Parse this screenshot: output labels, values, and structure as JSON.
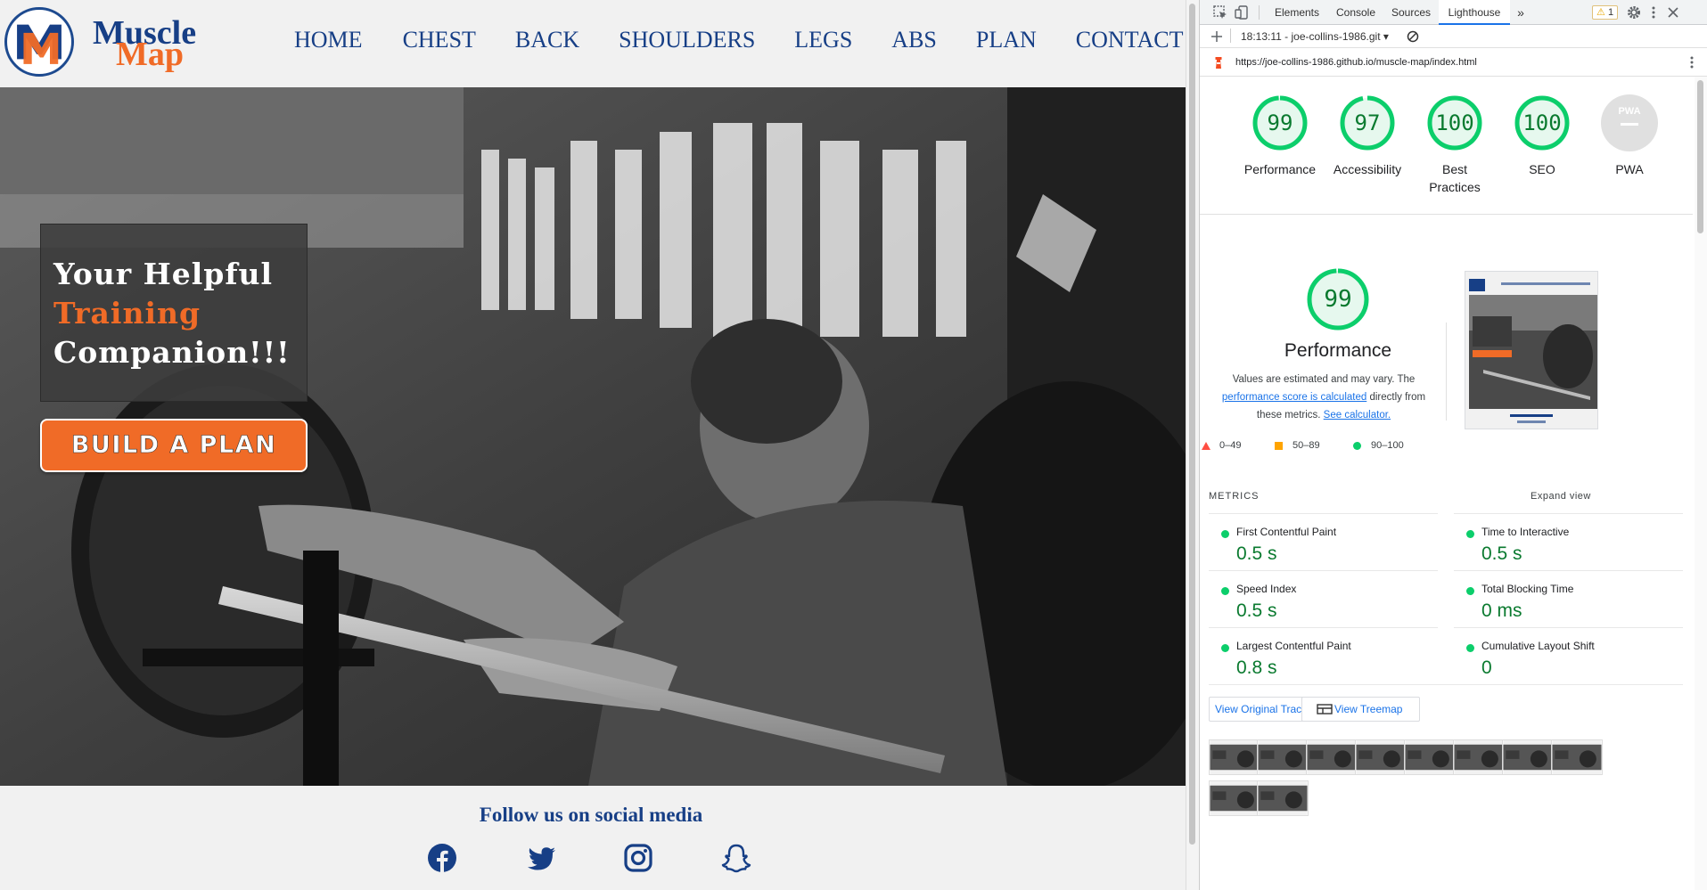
{
  "site": {
    "logo_line1": "Muscle",
    "logo_line2": "Map",
    "nav": [
      "HOME",
      "CHEST",
      "BACK",
      "SHOULDERS",
      "LEGS",
      "ABS",
      "PLAN",
      "CONTACT"
    ],
    "hero": {
      "line1": "Your Helpful",
      "line2": "Training",
      "line3": "Companion!!!",
      "cta": "BUILD A PLAN"
    },
    "social_title": "Follow us on social media",
    "social_icons": [
      "facebook-icon",
      "twitter-icon",
      "instagram-icon",
      "snapchat-icon"
    ],
    "colors": {
      "brand_blue": "#173f86",
      "brand_orange": "#f06b27"
    }
  },
  "devtools": {
    "tabs": [
      "Elements",
      "Console",
      "Sources",
      "Lighthouse"
    ],
    "active_tab": "Lighthouse",
    "more_tabs": "»",
    "warning_count": "1",
    "report_selector": "18:13:11 - joe-collins-1986.git ▾",
    "url": "https://joe-collins-1986.github.io/muscle-map/index.html",
    "scores": [
      {
        "label": "Performance",
        "value": "99"
      },
      {
        "label": "Accessibility",
        "value": "97"
      },
      {
        "label": "Best\nPractices",
        "value": "100"
      },
      {
        "label": "SEO",
        "value": "100"
      },
      {
        "label": "PWA",
        "value": "PWA"
      }
    ],
    "performance": {
      "score": "99",
      "title": "Performance",
      "desc_1": "Values are estimated and may vary. The",
      "desc_link1": "performance score is calculated",
      "desc_2": "directly from",
      "desc_3": "these metrics.",
      "desc_link2": "See calculator.",
      "legend": [
        "0–49",
        "50–89",
        "90–100"
      ]
    },
    "metrics_title": "METRICS",
    "expand_view": "Expand view",
    "metrics": [
      {
        "name": "First Contentful Paint",
        "value": "0.5 s"
      },
      {
        "name": "Time to Interactive",
        "value": "0.5 s"
      },
      {
        "name": "Speed Index",
        "value": "0.5 s"
      },
      {
        "name": "Total Blocking Time",
        "value": "0 ms"
      },
      {
        "name": "Largest Contentful Paint",
        "value": "0.8 s"
      },
      {
        "name": "Cumulative Layout Shift",
        "value": "0"
      }
    ],
    "view_trace": "View Original Trace",
    "view_treemap": "View Treemap",
    "score_colors": {
      "pass": "#0cce6b",
      "average": "#ffa400",
      "fail": "#ff4e42"
    }
  }
}
